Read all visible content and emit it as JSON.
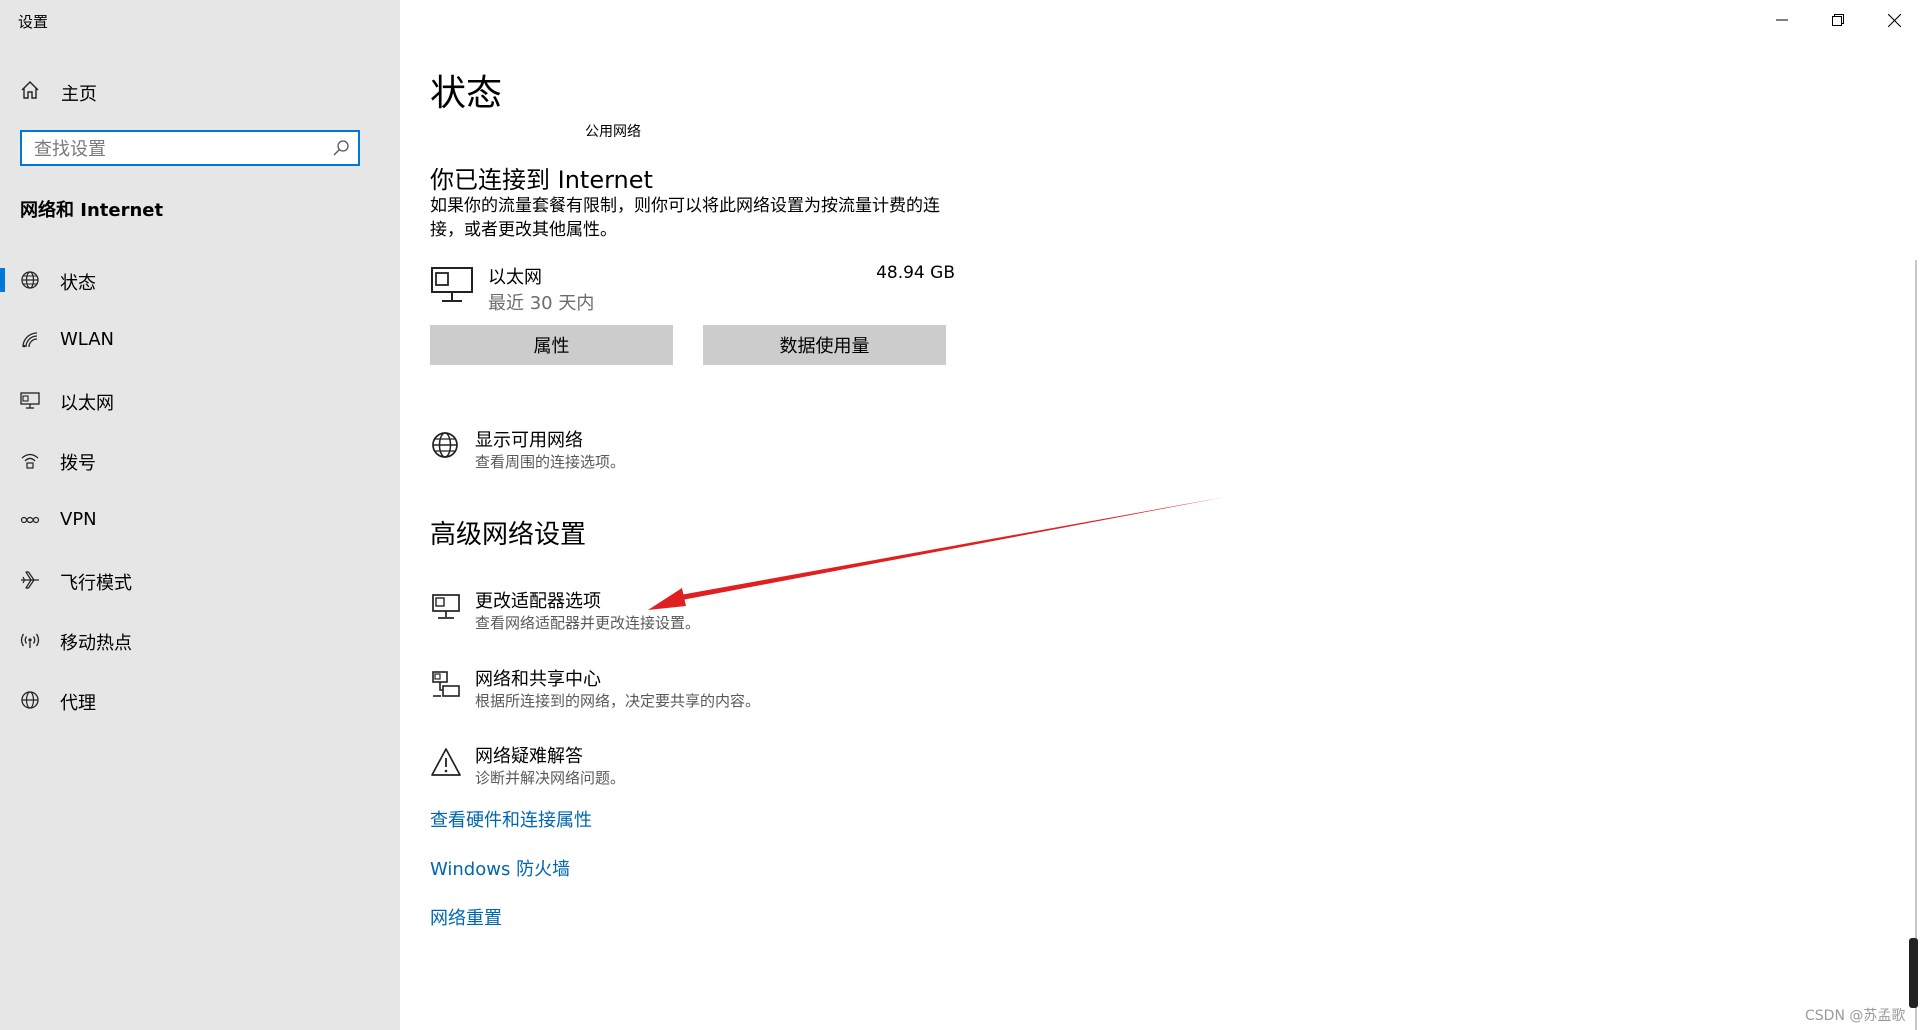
{
  "app": {
    "title": "设置",
    "window_controls": {
      "minimize": "minimize-icon",
      "restore": "restore-icon",
      "close": "close-icon"
    }
  },
  "sidebar": {
    "home_label": "主页",
    "search_placeholder": "查找设置",
    "section_title": "网络和 Internet",
    "accent_color": "#0078d7",
    "items": [
      {
        "label": "状态",
        "icon": "globe-icon",
        "selected": true
      },
      {
        "label": "WLAN",
        "icon": "wifi-icon",
        "selected": false
      },
      {
        "label": "以太网",
        "icon": "ethernet-icon",
        "selected": false
      },
      {
        "label": "拨号",
        "icon": "dialup-icon",
        "selected": false
      },
      {
        "label": "VPN",
        "icon": "vpn-icon",
        "selected": false
      },
      {
        "label": "飞行模式",
        "icon": "airplane-icon",
        "selected": false
      },
      {
        "label": "移动热点",
        "icon": "hotspot-icon",
        "selected": false
      },
      {
        "label": "代理",
        "icon": "proxy-globe-icon",
        "selected": false
      }
    ]
  },
  "main": {
    "title": "状态",
    "network_type": "公用网络",
    "connected_title": "你已连接到 Internet",
    "connected_desc": "如果你的流量套餐有限制，则你可以将此网络设置为按流量计费的连接，或者更改其他属性。",
    "ethernet": {
      "name": "以太网",
      "period": "最近 30 天内",
      "usage": "48.94 GB"
    },
    "buttons": {
      "properties": "属性",
      "data_usage": "数据使用量"
    },
    "show_networks": {
      "title": "显示可用网络",
      "desc": "查看周围的连接选项。"
    },
    "advanced_title": "高级网络设置",
    "advanced_options": [
      {
        "title": "更改适配器选项",
        "desc": "查看网络适配器并更改连接设置。",
        "icon": "adapter-icon"
      },
      {
        "title": "网络和共享中心",
        "desc": "根据所连接到的网络，决定要共享的内容。",
        "icon": "sharing-center-icon"
      },
      {
        "title": "网络疑难解答",
        "desc": "诊断并解决网络问题。",
        "icon": "warning-icon"
      }
    ],
    "links": [
      "查看硬件和连接属性",
      "Windows 防火墙",
      "网络重置"
    ],
    "link_color": "#0066b4",
    "annotation_arrow_color": "#e02020"
  },
  "watermark": "CSDN @苏孟歌"
}
